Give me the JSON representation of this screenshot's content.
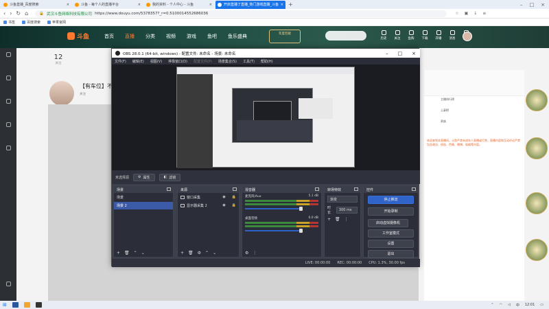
{
  "browser": {
    "tabs": [
      {
        "label": "斗鱼直播_百度搜索",
        "active": false
      },
      {
        "label": "斗鱼 - 每个人的直播平台",
        "active": false
      },
      {
        "label": "我的资料 - 个人中心 - 斗鱼",
        "active": false
      },
      {
        "label": "开启直播了直播_热门游戏直播_斗鱼",
        "active": true
      }
    ],
    "site_name": "武汉斗鱼网络科技有限公司",
    "url": "https://www.douyu.com/5378357?_r=0.5100014552686036",
    "bookmarks": [
      "书签",
      "百度搜索",
      "苹果官网"
    ]
  },
  "douyu": {
    "logo": "斗鱼",
    "nav": [
      "首页",
      "直播",
      "分类",
      "视频",
      "游戏",
      "鱼吧",
      "鱼乐盛典"
    ],
    "nav_active": 1,
    "promo": "年度巨献",
    "search_placeholder": "",
    "header_icons": [
      "历史",
      "关注",
      "鱼购",
      "下载",
      "开播",
      "消息",
      "鱼塘"
    ],
    "count": "12",
    "count_label": "关注",
    "room_title": "【有车位】不",
    "room_tag": "关注",
    "right_text": "欢迎来到本直播间，斗鱼严禁未成年人直播或打赏，直播内容和互动评论严禁包含政治、低俗、色情、赌博、吸烟等内容。",
    "rank_items": [
      "主播排行榜",
      "土豪榜",
      "贵族"
    ]
  },
  "obs": {
    "title": "OBS 28.0.1 (64-bit, windows) - 配置文件: 未命名 - 场景: 未命名",
    "menu": [
      "文件(F)",
      "编辑(E)",
      "视图(V)",
      "停靠窗口(D)",
      "配置文件(P)",
      "场景集合(S)",
      "工具(T)",
      "帮助(H)"
    ],
    "no_source": "未选择源",
    "props_btn": "属性",
    "filters_btn": "滤镜",
    "docks": {
      "scenes": "场景",
      "sources": "来源",
      "mixer": "混音器",
      "transitions": "转场特效",
      "controls": "控件"
    },
    "scenes": [
      "场景",
      "场景 2"
    ],
    "selected_scene": 1,
    "sources": [
      "窗口采集",
      "显示器采集 2"
    ],
    "mixer": [
      {
        "name": "麦克风/Aux",
        "db": "5.1 dB"
      },
      {
        "name": "桌面音频",
        "db": "0.0 dB"
      }
    ],
    "transition": "渐变",
    "duration_label": "时长",
    "duration": "300 ms",
    "controls": [
      "停止推流",
      "开始录制",
      "启动虚拟摄像机",
      "工作室模式",
      "设置",
      "退出"
    ],
    "status": {
      "live": "LIVE: 00:00:00",
      "rec": "REC: 00:00:00",
      "cpu": "CPU: 1.3%, 30.00 fps"
    }
  },
  "taskbar": {
    "time": "12:01",
    "tray_lang": "中"
  },
  "colors": {
    "obs_bg": "#2b2e38",
    "obs_accent": "#3164c9",
    "douyu_orange": "#ff7a2e",
    "chrome_tab": "#1a73e8"
  }
}
